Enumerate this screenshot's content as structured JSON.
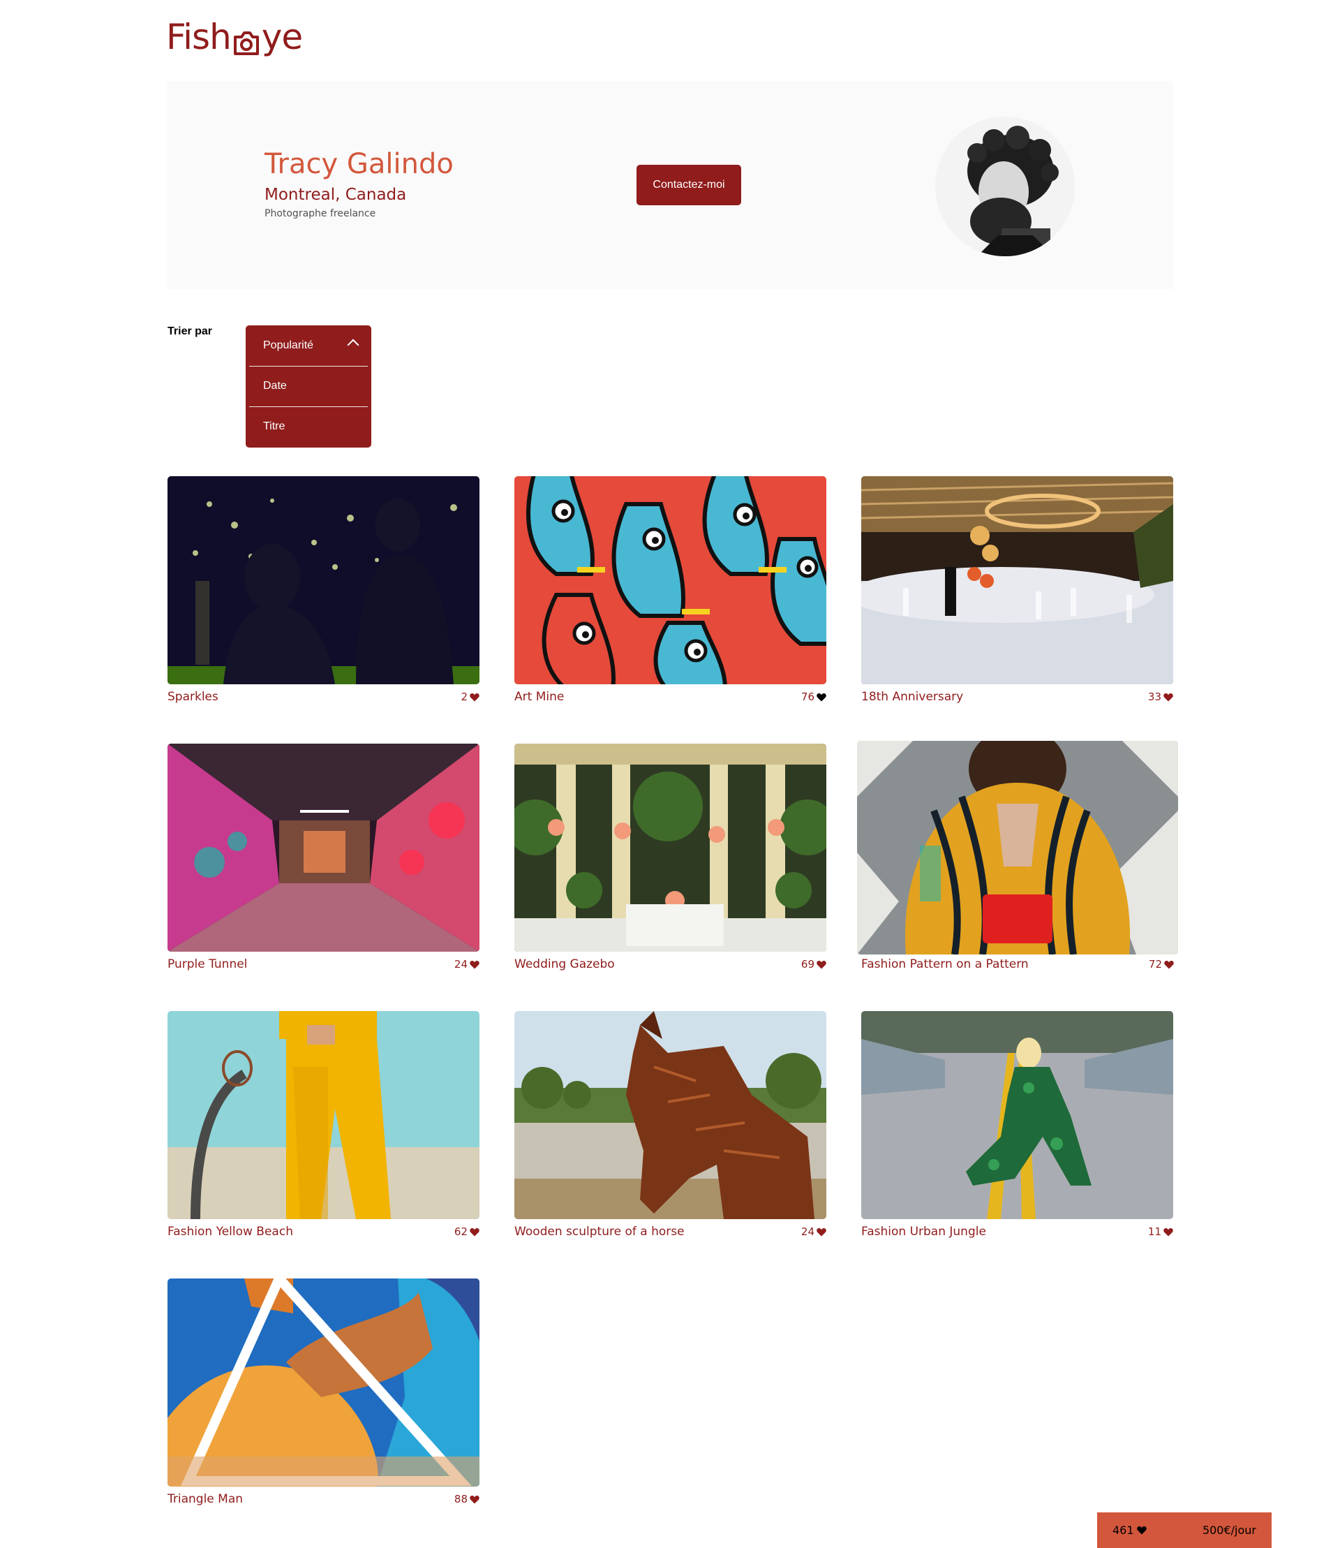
{
  "header": {
    "logo_left": "Fish",
    "logo_right": "ye",
    "logo_icon": "camera-icon"
  },
  "photographer": {
    "name": "Tracy Galindo",
    "location": "Montreal, Canada",
    "tagline": "Photographe freelance",
    "contact_label": "Contactez-moi"
  },
  "sort": {
    "label": "Trier par",
    "options": [
      "Popularité",
      "Date",
      "Titre"
    ],
    "selected": "Popularité"
  },
  "gallery": [
    {
      "title": "Sparkles",
      "likes": "2"
    },
    {
      "title": "Art Mine",
      "likes": "76"
    },
    {
      "title": "18th Anniversary",
      "likes": "33"
    },
    {
      "title": "Purple Tunnel",
      "likes": "24"
    },
    {
      "title": "Wedding Gazebo",
      "likes": "69"
    },
    {
      "title": "Fashion Pattern on a Pattern",
      "likes": "72"
    },
    {
      "title": "Fashion Yellow Beach",
      "likes": "62"
    },
    {
      "title": "Wooden sculpture of a horse",
      "likes": "24"
    },
    {
      "title": "Fashion Urban Jungle",
      "likes": "11"
    },
    {
      "title": "Triangle Man",
      "likes": "88"
    }
  ],
  "footer": {
    "total_likes": "461",
    "price": "500€/jour"
  },
  "colors": {
    "primary": "#901c1c",
    "secondary": "#d3573c",
    "banner_bg": "#fafafa"
  }
}
